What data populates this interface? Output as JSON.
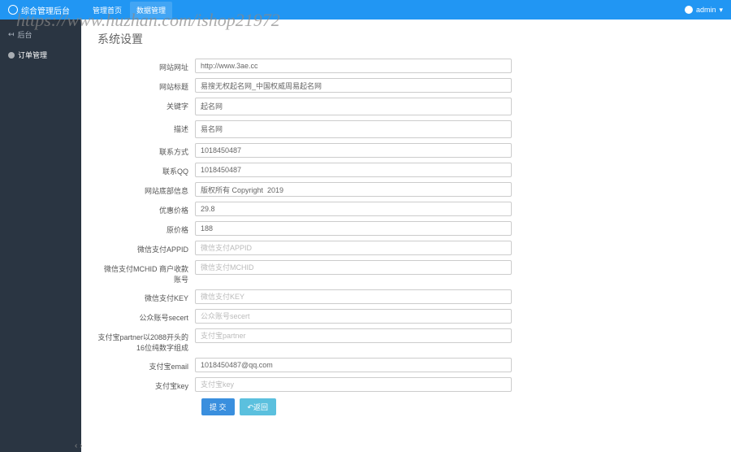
{
  "watermark": "https://www.huzhan.com/ishop21972",
  "header": {
    "brand": "综合管理后台",
    "nav": [
      {
        "label": "管理首页",
        "active": false
      },
      {
        "label": "数据管理",
        "active": true
      }
    ],
    "user": {
      "name": "admin",
      "caret": "▾"
    }
  },
  "sidebar": {
    "items": [
      {
        "label": "后台",
        "icon": "back"
      },
      {
        "label": "订单管理",
        "icon": "circle",
        "current": true
      }
    ]
  },
  "page": {
    "title": "系统设置"
  },
  "form": {
    "fields": [
      {
        "label": "网站网址",
        "value": "http://www.3ae.cc",
        "type": "input"
      },
      {
        "label": "网站标题",
        "value": "易搜无权起名网_中国权威周易起名网",
        "type": "input"
      },
      {
        "label": "关键字",
        "value": "起名网",
        "type": "textarea"
      },
      {
        "label": "描述",
        "value": "易名网",
        "type": "textarea"
      },
      {
        "label": "联系方式",
        "value": "1018450487",
        "type": "input"
      },
      {
        "label": "联系QQ",
        "value": "1018450487",
        "type": "input"
      },
      {
        "label": "网站底部信息",
        "value": "版权所有 Copyright  2019",
        "type": "input"
      },
      {
        "label": "优惠价格",
        "value": "29.8",
        "type": "input"
      },
      {
        "label": "原价格",
        "value": "188",
        "type": "input"
      },
      {
        "label": "微信支付APPID",
        "value": "",
        "placeholder": "微信支付APPID",
        "type": "input"
      },
      {
        "label": "微信支付MCHID 商户收款账号",
        "value": "",
        "placeholder": "微信支付MCHID",
        "type": "input"
      },
      {
        "label": "微信支付KEY",
        "value": "",
        "placeholder": "微信支付KEY",
        "type": "input"
      },
      {
        "label": "公众账号secert",
        "value": "",
        "placeholder": "公众账号secert",
        "type": "input"
      },
      {
        "label": "支付宝partner以2088开头的16位纯数字组成",
        "value": "",
        "placeholder": "支付宝partner",
        "type": "input"
      },
      {
        "label": "支付宝email",
        "value": "1018450487@qq.com",
        "type": "input"
      },
      {
        "label": "支付宝key",
        "value": "",
        "placeholder": "支付宝key",
        "type": "input"
      }
    ],
    "buttons": {
      "submit": "提 交",
      "back": "↶返回"
    }
  }
}
